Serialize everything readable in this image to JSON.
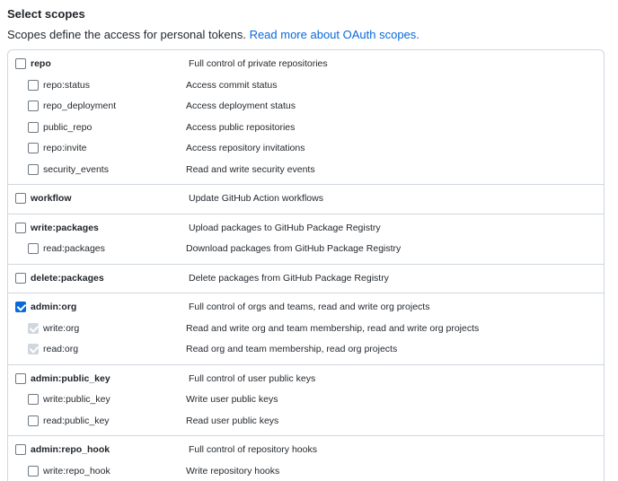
{
  "header": {
    "title": "Select scopes",
    "description": "Scopes define the access for personal tokens.",
    "link_text": "Read more about OAuth scopes."
  },
  "groups": [
    {
      "id": "repo",
      "parent": {
        "name": "repo",
        "description": "Full control of private repositories",
        "checked": false
      },
      "children": [
        {
          "name": "repo:status",
          "description": "Access commit status",
          "state": "unchecked"
        },
        {
          "name": "repo_deployment",
          "description": "Access deployment status",
          "state": "unchecked"
        },
        {
          "name": "public_repo",
          "description": "Access public repositories",
          "state": "unchecked"
        },
        {
          "name": "repo:invite",
          "description": "Access repository invitations",
          "state": "unchecked"
        },
        {
          "name": "security_events",
          "description": "Read and write security events",
          "state": "unchecked"
        }
      ]
    },
    {
      "id": "workflow",
      "parent": {
        "name": "workflow",
        "description": "Update GitHub Action workflows",
        "checked": false
      },
      "children": []
    },
    {
      "id": "write-packages",
      "parent": {
        "name": "write:packages",
        "description": "Upload packages to GitHub Package Registry",
        "checked": false
      },
      "children": [
        {
          "name": "read:packages",
          "description": "Download packages from GitHub Package Registry",
          "state": "unchecked"
        }
      ]
    },
    {
      "id": "delete-packages",
      "parent": {
        "name": "delete:packages",
        "description": "Delete packages from GitHub Package Registry",
        "checked": false
      },
      "children": []
    },
    {
      "id": "admin-org",
      "parent": {
        "name": "admin:org",
        "description": "Full control of orgs and teams, read and write org projects",
        "checked": true
      },
      "children": [
        {
          "name": "write:org",
          "description": "Read and write org and team membership, read and write org projects",
          "state": "checked-disabled"
        },
        {
          "name": "read:org",
          "description": "Read org and team membership, read org projects",
          "state": "checked-disabled"
        }
      ]
    },
    {
      "id": "admin-public-key",
      "parent": {
        "name": "admin:public_key",
        "description": "Full control of user public keys",
        "checked": false
      },
      "children": [
        {
          "name": "write:public_key",
          "description": "Write user public keys",
          "state": "unchecked"
        },
        {
          "name": "read:public_key",
          "description": "Read user public keys",
          "state": "unchecked"
        }
      ]
    },
    {
      "id": "admin-repo-hook",
      "parent": {
        "name": "admin:repo_hook",
        "description": "Full control of repository hooks",
        "checked": false
      },
      "children": [
        {
          "name": "write:repo_hook",
          "description": "Write repository hooks",
          "state": "unchecked"
        }
      ]
    }
  ],
  "colors": {
    "link": "#0969da",
    "checkbox_checked": "#0969da",
    "checkbox_disabled": "#d0d7de",
    "border": "#d0d7de"
  }
}
